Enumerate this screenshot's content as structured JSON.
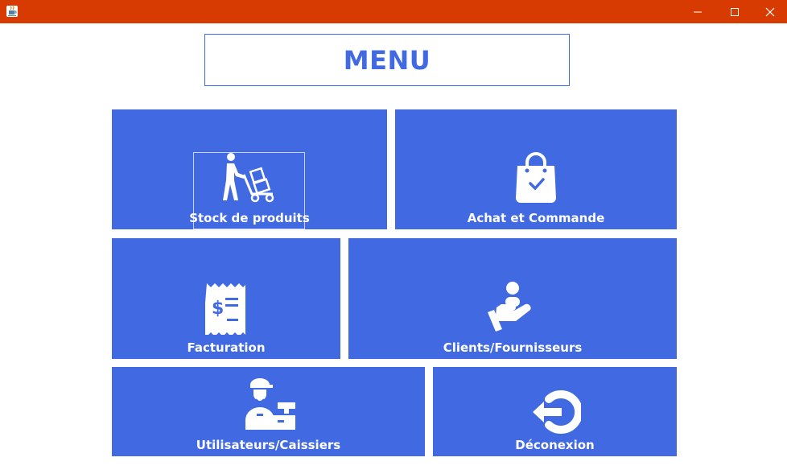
{
  "window": {
    "title": "",
    "app_icon": "java-cup-icon",
    "controls": [
      "minimize-icon",
      "maximize-icon",
      "close-icon"
    ],
    "titlebar_color": "#d83b01"
  },
  "header": {
    "title": "MENU"
  },
  "tiles": [
    {
      "label": "Stock de produits",
      "icon": "hand-truck-icon"
    },
    {
      "label": "Achat et Commande",
      "icon": "shopping-bag-icon"
    },
    {
      "label": "Facturation",
      "icon": "receipt-icon"
    },
    {
      "label": "Clients/Fournisseurs",
      "icon": "hand-person-icon"
    },
    {
      "label": "Utilisateurs/Caissiers",
      "icon": "cashier-icon"
    },
    {
      "label": "Déconexion",
      "icon": "logout-icon"
    }
  ],
  "colors": {
    "accent": "#4169e1",
    "text_on_accent": "#ffffff"
  }
}
